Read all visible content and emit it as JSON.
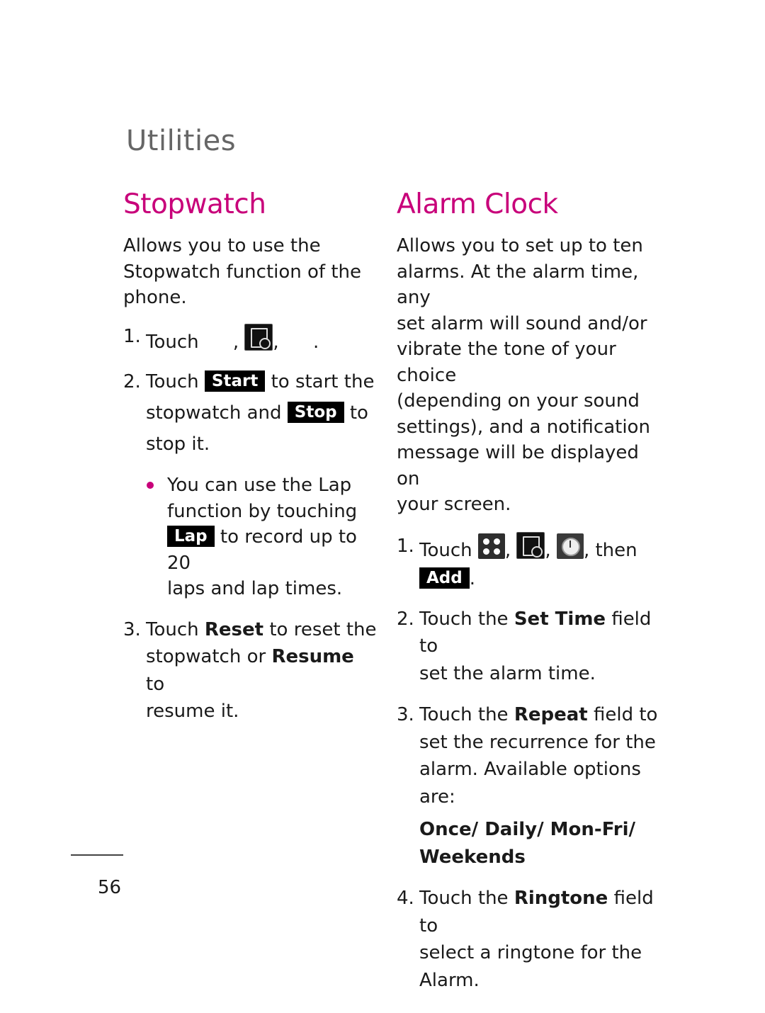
{
  "section_title": "Utilities",
  "accent_color": "#c8007a",
  "stopwatch": {
    "heading": "Stopwatch",
    "intro": [
      "Allows you to use the",
      "Stopwatch function of the",
      "phone."
    ],
    "step1": {
      "num": "1.",
      "text": "Touch",
      "sep1": ",",
      "icon": "stopwatch-icon",
      "sep2": ",",
      "end": "."
    },
    "step2": {
      "num": "2.",
      "pre": "Touch",
      "btn_start": "Start",
      "mid1": "to start the",
      "mid2": "stopwatch and",
      "btn_stop": "Stop",
      "mid3": "to",
      "end": "stop it."
    },
    "bullet": {
      "l1": "You can use the Lap",
      "l2": "function by touching",
      "btn_lap": "Lap",
      "l3": "to record up to 20",
      "l4": "laps and lap times."
    },
    "step3": {
      "num": "3.",
      "pre": "Touch",
      "reset": "Reset",
      "mid": "to reset the",
      "l2pre": "stopwatch or",
      "resume": "Resume",
      "l2post": "to",
      "l3": "resume it."
    }
  },
  "alarm": {
    "heading": "Alarm Clock",
    "intro": [
      "Allows you to set up to ten",
      "alarms. At the alarm time, any",
      "set alarm will sound and/or",
      "vibrate the tone of your choice",
      "(depending on your sound",
      "settings), and a notification",
      "message will be displayed on",
      "your screen."
    ],
    "step1": {
      "num": "1.",
      "text": "Touch",
      "icons": [
        "menu-icon",
        "stopwatch-icon",
        "alarm-clock-icon"
      ],
      "sep": ",",
      "then": ", then",
      "btn_add": "Add",
      "end": "."
    },
    "step2": {
      "num": "2.",
      "pre": "Touch the",
      "field": "Set Time",
      "post": "field to",
      "l2": "set the alarm time."
    },
    "step3": {
      "num": "3.",
      "pre": "Touch the",
      "field": "Repeat",
      "post": "field to",
      "l2": "set the recurrence for the",
      "l3": "alarm. Available options are:"
    },
    "options": {
      "l1": "Once/ Daily/ Mon-Fri/",
      "l2": "Weekends"
    },
    "step4": {
      "num": "4.",
      "pre": "Touch the",
      "field": "Ringtone",
      "post": "field to",
      "l2": "select a ringtone for the",
      "l3": "Alarm."
    }
  },
  "page_number": "56"
}
